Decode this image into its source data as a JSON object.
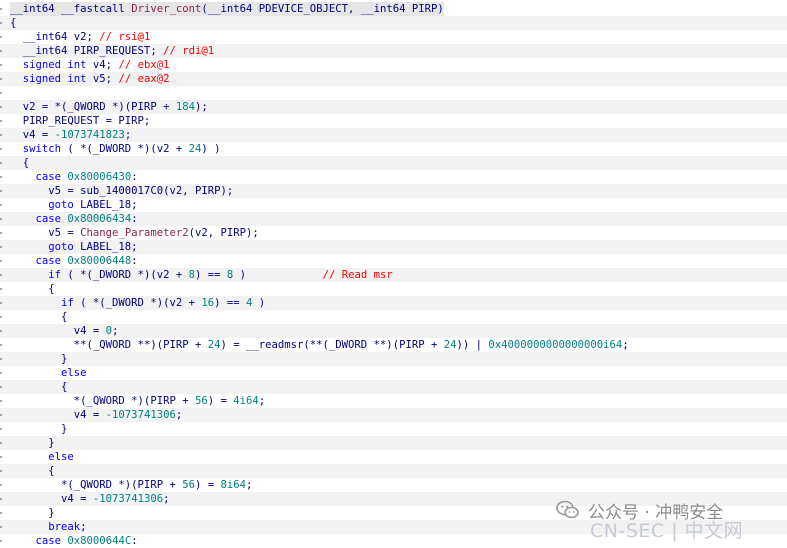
{
  "code": {
    "lines": [
      [
        [
          "plain",
          "__int64 __fastcall "
        ],
        [
          "fn",
          "Driver_cont"
        ],
        [
          "plain",
          "(__int64 PDEVICE_OBJECT, __int64 PIRP)"
        ]
      ],
      [
        [
          "plain",
          "{"
        ]
      ],
      [
        [
          "plain",
          "  __int64 v2; "
        ],
        [
          "cmt",
          "// rsi@1"
        ]
      ],
      [
        [
          "plain",
          "  __int64 PIRP_REQUEST; "
        ],
        [
          "cmt",
          "// rdi@1"
        ]
      ],
      [
        [
          "kw",
          "  signed int"
        ],
        [
          "plain",
          " v4; "
        ],
        [
          "cmt",
          "// ebx@1"
        ]
      ],
      [
        [
          "kw",
          "  signed int"
        ],
        [
          "plain",
          " v5; "
        ],
        [
          "cmt",
          "// eax@2"
        ]
      ],
      [
        [
          "plain",
          ""
        ]
      ],
      [
        [
          "plain",
          "  v2 = *(_QWORD *)(PIRP + "
        ],
        [
          "num",
          "184"
        ],
        [
          "plain",
          ");"
        ]
      ],
      [
        [
          "plain",
          "  PIRP_REQUEST = PIRP;"
        ]
      ],
      [
        [
          "plain",
          "  v4 = "
        ],
        [
          "num",
          "-1073741823"
        ],
        [
          "plain",
          ";"
        ]
      ],
      [
        [
          "kw",
          "  switch"
        ],
        [
          "plain",
          " ( *(_DWORD *)(v2 + "
        ],
        [
          "num",
          "24"
        ],
        [
          "plain",
          ") )"
        ]
      ],
      [
        [
          "plain",
          "  {"
        ]
      ],
      [
        [
          "kw",
          "    case"
        ],
        [
          "plain",
          " "
        ],
        [
          "num",
          "0x80006430"
        ],
        [
          "plain",
          ":"
        ]
      ],
      [
        [
          "plain",
          "      v5 = sub_1400017C0(v2, PIRP);"
        ]
      ],
      [
        [
          "kw",
          "      goto"
        ],
        [
          "plain",
          " LABEL_18;"
        ]
      ],
      [
        [
          "kw",
          "    case"
        ],
        [
          "plain",
          " "
        ],
        [
          "num",
          "0x80006434"
        ],
        [
          "plain",
          ":"
        ]
      ],
      [
        [
          "plain",
          "      v5 = "
        ],
        [
          "fn",
          "Change_Parameter2"
        ],
        [
          "plain",
          "(v2, PIRP);"
        ]
      ],
      [
        [
          "kw",
          "      goto"
        ],
        [
          "plain",
          " LABEL_18;"
        ]
      ],
      [
        [
          "kw",
          "    case"
        ],
        [
          "plain",
          " "
        ],
        [
          "num",
          "0x80006448"
        ],
        [
          "plain",
          ":"
        ]
      ],
      [
        [
          "kw",
          "      if"
        ],
        [
          "plain",
          " ( *(_DWORD *)(v2 + "
        ],
        [
          "num",
          "8"
        ],
        [
          "plain",
          ") == "
        ],
        [
          "num",
          "8"
        ],
        [
          "plain",
          " )            "
        ],
        [
          "cmt",
          "// Read msr"
        ]
      ],
      [
        [
          "plain",
          "      {"
        ]
      ],
      [
        [
          "kw",
          "        if"
        ],
        [
          "plain",
          " ( *(_DWORD *)(v2 + "
        ],
        [
          "num",
          "16"
        ],
        [
          "plain",
          ") == "
        ],
        [
          "num",
          "4"
        ],
        [
          "plain",
          " )"
        ]
      ],
      [
        [
          "plain",
          "        {"
        ]
      ],
      [
        [
          "plain",
          "          v4 = "
        ],
        [
          "num",
          "0"
        ],
        [
          "plain",
          ";"
        ]
      ],
      [
        [
          "plain",
          "          **(_QWORD **)(PIRP + "
        ],
        [
          "num",
          "24"
        ],
        [
          "plain",
          ") = __readmsr(**(_DWORD **)(PIRP + "
        ],
        [
          "num",
          "24"
        ],
        [
          "plain",
          ")) | "
        ],
        [
          "num",
          "0x4000000000000000i64"
        ],
        [
          "plain",
          ";"
        ]
      ],
      [
        [
          "plain",
          "        }"
        ]
      ],
      [
        [
          "kw",
          "        else"
        ]
      ],
      [
        [
          "plain",
          "        {"
        ]
      ],
      [
        [
          "plain",
          "          *(_QWORD *)(PIRP + "
        ],
        [
          "num",
          "56"
        ],
        [
          "plain",
          ") = "
        ],
        [
          "num",
          "4i64"
        ],
        [
          "plain",
          ";"
        ]
      ],
      [
        [
          "plain",
          "          v4 = "
        ],
        [
          "num",
          "-1073741306"
        ],
        [
          "plain",
          ";"
        ]
      ],
      [
        [
          "plain",
          "        }"
        ]
      ],
      [
        [
          "plain",
          "      }"
        ]
      ],
      [
        [
          "kw",
          "      else"
        ]
      ],
      [
        [
          "plain",
          "      {"
        ]
      ],
      [
        [
          "plain",
          "        *(_QWORD *)(PIRP + "
        ],
        [
          "num",
          "56"
        ],
        [
          "plain",
          ") = "
        ],
        [
          "num",
          "8i64"
        ],
        [
          "plain",
          ";"
        ]
      ],
      [
        [
          "plain",
          "        v4 = "
        ],
        [
          "num",
          "-1073741306"
        ],
        [
          "plain",
          ";"
        ]
      ],
      [
        [
          "plain",
          "      }"
        ]
      ],
      [
        [
          "kw",
          "      break"
        ],
        [
          "plain",
          ";"
        ]
      ],
      [
        [
          "kw",
          "    case"
        ],
        [
          "plain",
          " "
        ],
        [
          "num",
          "0x8000644C"
        ],
        [
          "plain",
          ":"
        ]
      ]
    ]
  },
  "watermark": {
    "icon": "wechat-icon",
    "text": "公众号 · 冲鸭安全",
    "sub": "CN-SEC | 中文网"
  }
}
